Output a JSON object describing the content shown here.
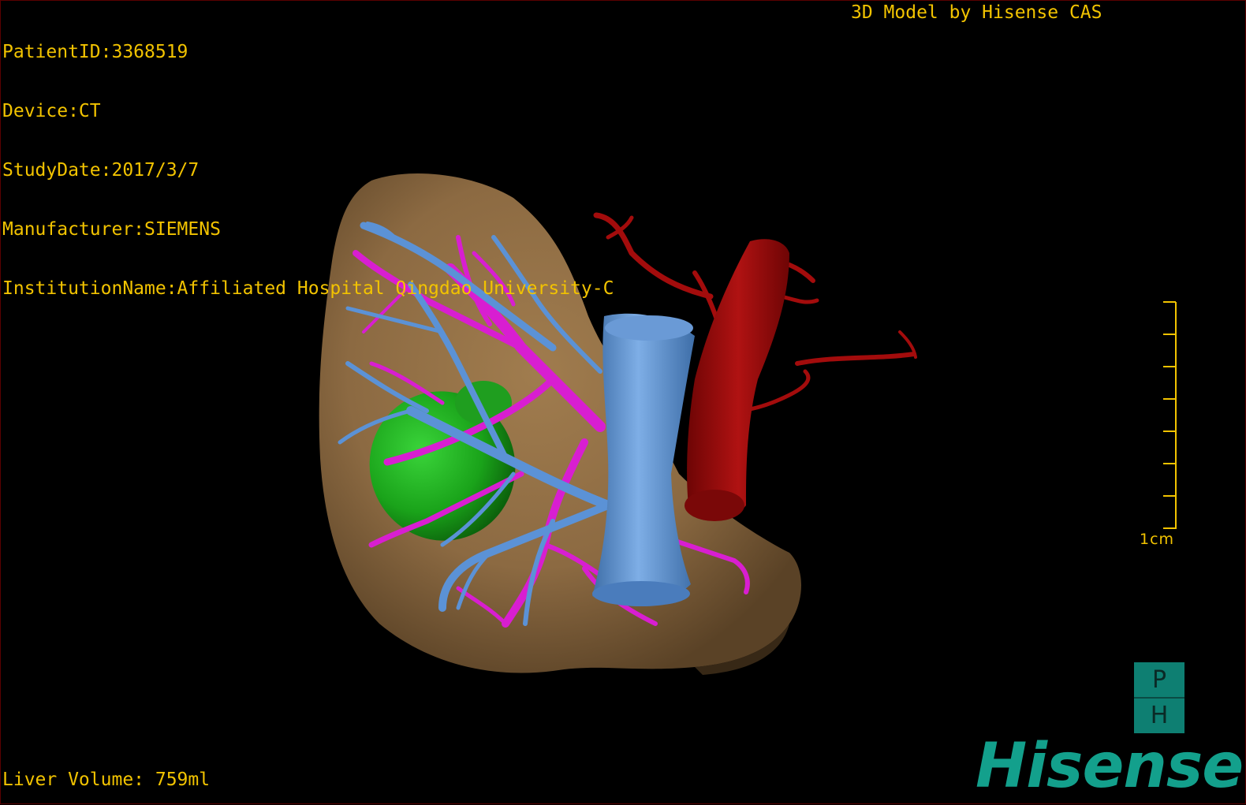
{
  "header": {
    "patient_line": "PatientID:3368519",
    "device_line": "Device:CT",
    "study_date_line": "StudyDate:2017/3/7",
    "manufacturer_line": "Manufacturer:SIEMENS",
    "institution_line": "InstitutionName:Affiliated Hospital Qingdao University-C"
  },
  "credit": {
    "label": "3D Model by Hisense CAS"
  },
  "footer": {
    "liver_volume_label": "Liver Volume: 759ml"
  },
  "scale": {
    "label": "1cm"
  },
  "orientation": {
    "top": "P",
    "bottom": "H"
  },
  "brand": {
    "name": "Hisense"
  },
  "colors": {
    "overlay_text": "#f2c300",
    "liver": "#8c6a42",
    "portal_vein": "#5b92d6",
    "hepatic_vein": "#d81ed1",
    "gallbladder": "#1aa31a",
    "aorta": "#a30c0c",
    "brand": "#13a08c"
  }
}
